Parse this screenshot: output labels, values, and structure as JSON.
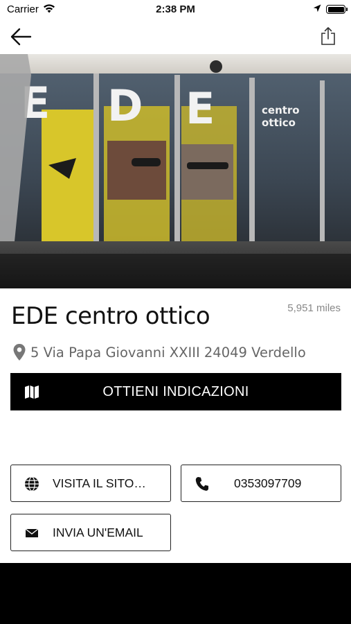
{
  "status_bar": {
    "carrier": "Carrier",
    "time": "2:38 PM",
    "battery_level": 1.0
  },
  "nav": {
    "back_icon": "arrow-left-icon",
    "share_icon": "share-icon"
  },
  "hero": {
    "sign_letters": [
      "E",
      "D",
      "E"
    ],
    "sign_text": [
      "centro",
      "ottico"
    ]
  },
  "store": {
    "name": "EDE centro ottico",
    "distance": "5,951 miles",
    "address": "5 Via Papa Giovanni XXIII 24049 Verdello"
  },
  "actions": {
    "directions_label": "OTTIENI INDICAZIONI",
    "website_label": "VISITA IL SITO…",
    "phone_label": "0353097709",
    "email_label": "INVIA UN'EMAIL"
  },
  "icons": {
    "pin": "map-pin-icon",
    "map": "map-icon",
    "globe": "globe-icon",
    "phone": "phone-icon",
    "mail": "envelope-icon"
  },
  "colors": {
    "primary_button_bg": "#000000",
    "primary_button_text": "#ffffff",
    "secondary_text": "#666666",
    "distance_text": "#888888",
    "border": "#222222"
  }
}
